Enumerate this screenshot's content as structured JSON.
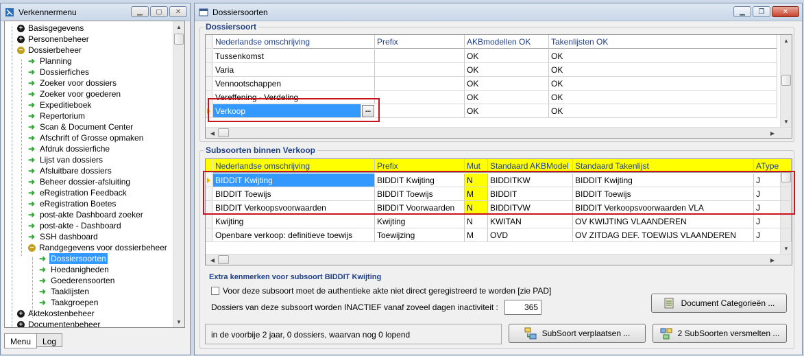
{
  "left_window": {
    "title": "Verkennermenu",
    "tree": [
      {
        "label": "Basisgegevens",
        "level": 0,
        "kind": "plus"
      },
      {
        "label": "Personenbeheer",
        "level": 0,
        "kind": "plus"
      },
      {
        "label": "Dossierbeheer",
        "level": 0,
        "kind": "minus"
      },
      {
        "label": "Planning",
        "level": 1,
        "kind": "arrow"
      },
      {
        "label": "Dossierfiches",
        "level": 1,
        "kind": "arrow"
      },
      {
        "label": "Zoeker voor dossiers",
        "level": 1,
        "kind": "arrow"
      },
      {
        "label": "Zoeker voor goederen",
        "level": 1,
        "kind": "arrow"
      },
      {
        "label": "Expeditieboek",
        "level": 1,
        "kind": "arrow"
      },
      {
        "label": "Repertorium",
        "level": 1,
        "kind": "arrow"
      },
      {
        "label": "Scan & Document Center",
        "level": 1,
        "kind": "arrow"
      },
      {
        "label": "Afschrift of Grosse opmaken",
        "level": 1,
        "kind": "arrow"
      },
      {
        "label": "Afdruk dossierfiche",
        "level": 1,
        "kind": "arrow"
      },
      {
        "label": "Lijst van dossiers",
        "level": 1,
        "kind": "arrow"
      },
      {
        "label": "Afsluitbare dossiers",
        "level": 1,
        "kind": "arrow"
      },
      {
        "label": "Beheer dossier-afsluiting",
        "level": 1,
        "kind": "arrow"
      },
      {
        "label": "eRegistration Feedback",
        "level": 1,
        "kind": "arrow"
      },
      {
        "label": "eRegistration Boetes",
        "level": 1,
        "kind": "arrow"
      },
      {
        "label": "post-akte Dashboard zoeker",
        "level": 1,
        "kind": "arrow"
      },
      {
        "label": "post-akte - Dashboard",
        "level": 1,
        "kind": "arrow"
      },
      {
        "label": "SSH dashboard",
        "level": 1,
        "kind": "arrow"
      },
      {
        "label": "Randgegevens voor dossierbeheer",
        "level": 1,
        "kind": "minus"
      },
      {
        "label": "Dossiersoorten",
        "level": 2,
        "kind": "arrow",
        "selected": true
      },
      {
        "label": "Hoedanigheden",
        "level": 2,
        "kind": "arrow"
      },
      {
        "label": "Goederensoorten",
        "level": 2,
        "kind": "arrow"
      },
      {
        "label": "Taaklijsten",
        "level": 2,
        "kind": "arrow"
      },
      {
        "label": "Taakgroepen",
        "level": 2,
        "kind": "arrow"
      },
      {
        "label": "Aktekostenbeheer",
        "level": 0,
        "kind": "plus"
      },
      {
        "label": "Documentenbeheer",
        "level": 0,
        "kind": "plus"
      }
    ],
    "tabs": [
      "Menu",
      "Log"
    ]
  },
  "right_window": {
    "title": "Dossiersoorten",
    "group1_title": "Dossiersoort",
    "grid1": {
      "headers": [
        "Nederlandse omschrijving",
        "Prefix",
        "AKBmodellen OK",
        "Takenlijsten OK"
      ],
      "rows": [
        [
          "Tussenkomst",
          "",
          "OK",
          "OK"
        ],
        [
          "Varia",
          "",
          "OK",
          "OK"
        ],
        [
          "Vennootschappen",
          "",
          "OK",
          "OK"
        ],
        [
          "Vereffening - Verdeling",
          "",
          "OK",
          "OK"
        ],
        [
          "Verkoop",
          "",
          "OK",
          "OK"
        ]
      ],
      "ellipsis": "..."
    },
    "group2_title": "Subsoorten binnen Verkoop",
    "grid2": {
      "headers": [
        "Nederlandse omschrijving",
        "Prefix",
        "Mut",
        "Standaard AKBModel",
        "Standaard Takenlijst",
        "AType"
      ],
      "rows": [
        [
          "BIDDIT Kwijting",
          "BIDDIT Kwijting",
          "N",
          "BIDDITKW",
          "BIDDIT Kwijting",
          "J"
        ],
        [
          "BIDDIT Toewijs",
          "BIDDIT Toewijs",
          "M",
          "BIDDIT",
          "BIDDIT Toewijs",
          "J"
        ],
        [
          "BIDDIT Verkoopsvoorwaarden",
          "BIDDIT Voorwaarden",
          "N",
          "BIDDITVW",
          "BIDDIT Verkoopsvoorwaarden VLA",
          "J"
        ],
        [
          "Kwijting",
          "Kwijting",
          "N",
          "KWITAN",
          "OV KWIJTING VLAANDEREN",
          "J"
        ],
        [
          "Openbare verkoop: definitieve toewijs",
          "Toewijzing",
          "M",
          "OVD",
          "OV ZITDAG DEF. TOEWIJS VLAANDEREN",
          "J"
        ]
      ]
    },
    "extra": {
      "title": "Extra kenmerken voor subsoort BIDDIT Kwijting",
      "checkbox_label": "Voor deze subsoort moet de authentieke akte niet direct geregistreerd te worden [zie PAD]",
      "inactive_label": "Dossiers van deze subsoort worden INACTIEF vanaf zoveel dagen inactiviteit :",
      "inactive_value": "365",
      "doc_button": "Document Categorieën ..."
    },
    "status_text": "in de voorbije 2 jaar, 0 dossiers, waarvan nog 0 lopend",
    "move_button": "SubSoort verplaatsen ...",
    "merge_button": "2 SubSoorten versmelten ..."
  },
  "colors": {
    "selection": "#3399ff",
    "highlight": "#ffff00",
    "red_box": "#c8121c",
    "group_title": "#1f3f87",
    "tree_arrow": "#35a935"
  }
}
